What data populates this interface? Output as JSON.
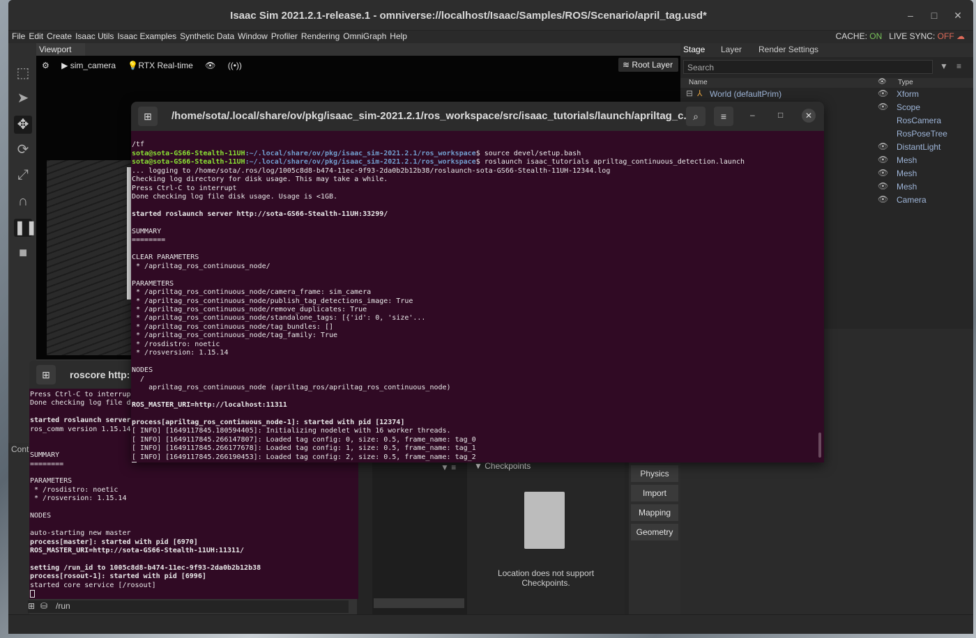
{
  "app": {
    "title": "Isaac Sim 2021.2.1-release.1 - omniverse://localhost/Isaac/Samples/ROS/Scenario/april_tag.usd*",
    "menu": [
      "File",
      "Edit",
      "Create",
      "Isaac Utils",
      "Isaac Examples",
      "Synthetic Data",
      "Window",
      "Profiler",
      "Rendering",
      "OmniGraph",
      "Help"
    ],
    "cache_label": "CACHE:",
    "cache_value": "ON",
    "livesync_label": "LIVE SYNC:",
    "livesync_value": "OFF"
  },
  "viewport": {
    "tab": "Viewport",
    "camera": "sim_camera",
    "render_mode": "RTX Real-time",
    "root_layer": "Root Layer"
  },
  "stage": {
    "tabs": [
      "Stage",
      "Layer",
      "Render Settings"
    ],
    "search_placeholder": "Search",
    "col_name": "Name",
    "col_type": "Type",
    "rows": [
      {
        "name": "World (defaultPrim)",
        "type": "Xform",
        "eye": true
      },
      {
        "name": "",
        "type": "Scope",
        "eye": true
      },
      {
        "name": "",
        "type": "RosCamera",
        "eye": false
      },
      {
        "name": "",
        "type": "RosPoseTree",
        "eye": false
      },
      {
        "name": "",
        "type": "DistantLight",
        "eye": true
      },
      {
        "name": "",
        "type": "Mesh",
        "eye": true
      },
      {
        "name": "",
        "type": "Mesh",
        "eye": true
      },
      {
        "name": "",
        "type": "Mesh",
        "eye": true
      },
      {
        "name": "",
        "type": "Camera",
        "eye": true
      }
    ]
  },
  "checkpoints": {
    "title": "Checkpoints",
    "message": "Location does not support Checkpoints."
  },
  "side_buttons": [
    "Physics",
    "Import",
    "Mapping",
    "Geometry"
  ],
  "content_path": "/run",
  "console_tab": "Cont",
  "terminal_main": {
    "title": "/home/sota/.local/share/ov/pkg/isaac_sim-2021.2.1/ros_workspace/src/isaac_tutorials/launch/apriltag_c...",
    "line_tf": "/tf",
    "prompt_user": "sota@sota-GS66-Stealth-11UH",
    "prompt_path": ":~/.local/share/ov/pkg/isaac_sim-2021.2.1/ros_workspace",
    "cmd1": "$ source devel/setup.bash",
    "cmd2": "$ roslaunch isaac_tutorials apriltag_continuous_detection.launch",
    "lines": [
      "... logging to /home/sota/.ros/log/1005c8d8-b474-11ec-9f93-2da0b2b12b38/roslaunch-sota-GS66-Stealth-11UH-12344.log",
      "Checking log directory for disk usage. This may take a while.",
      "Press Ctrl-C to interrupt",
      "Done checking log file disk usage. Usage is <1GB.",
      "",
      "started roslaunch server http://sota-GS66-Stealth-11UH:33299/",
      "",
      "SUMMARY",
      "========",
      "",
      "CLEAR PARAMETERS",
      " * /apriltag_ros_continuous_node/",
      "",
      "PARAMETERS",
      " * /apriltag_ros_continuous_node/camera_frame: sim_camera",
      " * /apriltag_ros_continuous_node/publish_tag_detections_image: True",
      " * /apriltag_ros_continuous_node/remove_duplicates: True",
      " * /apriltag_ros_continuous_node/standalone_tags: [{'id': 0, 'size'...",
      " * /apriltag_ros_continuous_node/tag_bundles: []",
      " * /apriltag_ros_continuous_node/tag_family: True",
      " * /rosdistro: noetic",
      " * /rosversion: 1.15.14",
      "",
      "NODES",
      "  /",
      "    apriltag_ros_continuous_node (apriltag_ros/apriltag_ros_continuous_node)",
      "",
      "ROS_MASTER_URI=http://localhost:11311",
      "",
      "process[apriltag_ros_continuous_node-1]: started with pid [12374]",
      "[ INFO] [1649117845.180594405]: Initializing nodelet with 16 worker threads.",
      "[ INFO] [1649117845.266147807]: Loaded tag config: 0, size: 0.5, frame_name: tag_0",
      "[ INFO] [1649117845.266177678]: Loaded tag config: 1, size: 0.5, frame_name: tag_1",
      "[ INFO] [1649117845.266190453]: Loaded tag config: 2, size: 0.5, frame_name: tag_2"
    ]
  },
  "terminal_roscore": {
    "title": "roscore http:",
    "lines": [
      "Press Ctrl-C to interrupt",
      "Done checking log file di",
      "",
      "started roslaunch server",
      "ros_comm version 1.15.14",
      "",
      "",
      "SUMMARY",
      "========",
      "",
      "PARAMETERS",
      " * /rosdistro: noetic",
      " * /rosversion: 1.15.14",
      "",
      "NODES",
      "",
      "auto-starting new master",
      "process[master]: started with pid [6970]",
      "ROS_MASTER_URI=http://sota-GS66-Stealth-11UH:11311/",
      "",
      "setting /run_id to 1005c8d8-b474-11ec-9f93-2da0b2b12b38",
      "process[rosout-1]: started with pid [6996]",
      "started core service [/rosout]"
    ]
  }
}
